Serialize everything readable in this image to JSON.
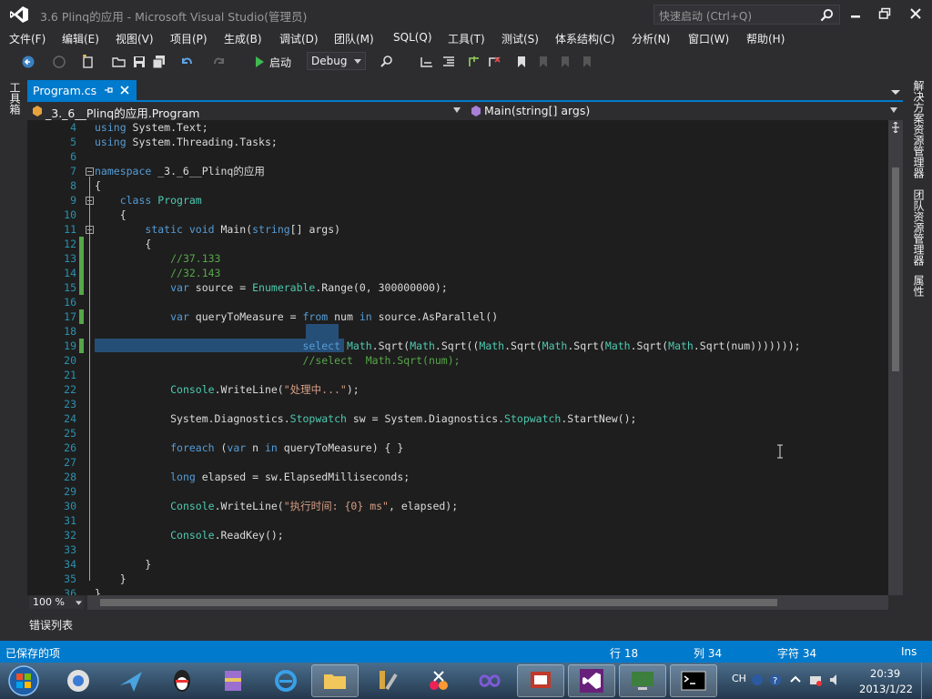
{
  "window": {
    "title": "3.6  Plinq的应用 - Microsoft Visual Studio(管理员)",
    "quick_launch_placeholder": "快速启动 (Ctrl+Q)"
  },
  "menu": [
    "文件(F)",
    "编辑(E)",
    "视图(V)",
    "项目(P)",
    "生成(B)",
    "调试(D)",
    "团队(M)",
    "SQL(Q)",
    "工具(T)",
    "测试(S)",
    "体系结构(C)",
    "分析(N)",
    "窗口(W)",
    "帮助(H)"
  ],
  "toolbar": {
    "run_label": "启动",
    "configuration": "Debug"
  },
  "side_tabs": {
    "left": "工具箱",
    "right": [
      "解决方案资源管理器",
      "团队资源管理器",
      "属性"
    ]
  },
  "document": {
    "tab_label": "Program.cs",
    "nav_class": "_3._6__Plinq的应用.Program",
    "nav_member": "Main(string[] args)"
  },
  "code": {
    "line_numbers": [
      "4",
      "5",
      "6",
      "7",
      "8",
      "9",
      "10",
      "11",
      "12",
      "13",
      "14",
      "15",
      "16",
      "17",
      "18",
      "19",
      "20",
      "21",
      "22",
      "23",
      "24",
      "25",
      "26",
      "27",
      "28",
      "29",
      "30",
      "31",
      "32",
      "33",
      "34",
      "35",
      "36"
    ]
  },
  "editor_footer": {
    "zoom": "100 %",
    "error_list_tab": "错误列表"
  },
  "status": {
    "message": "已保存的项",
    "line": "行 18",
    "col": "列 34",
    "char": "字符 34",
    "mode": "Ins"
  },
  "taskbar": {
    "ime": "CH",
    "time": "20:39",
    "date": "2013/1/22"
  },
  "colors": {
    "accent": "#007acc",
    "keyword": "#569cd6",
    "type": "#4ec9b0",
    "comment": "#57a64a",
    "string": "#d69d85",
    "line_number": "#2b91af",
    "selection": "#264f78"
  }
}
